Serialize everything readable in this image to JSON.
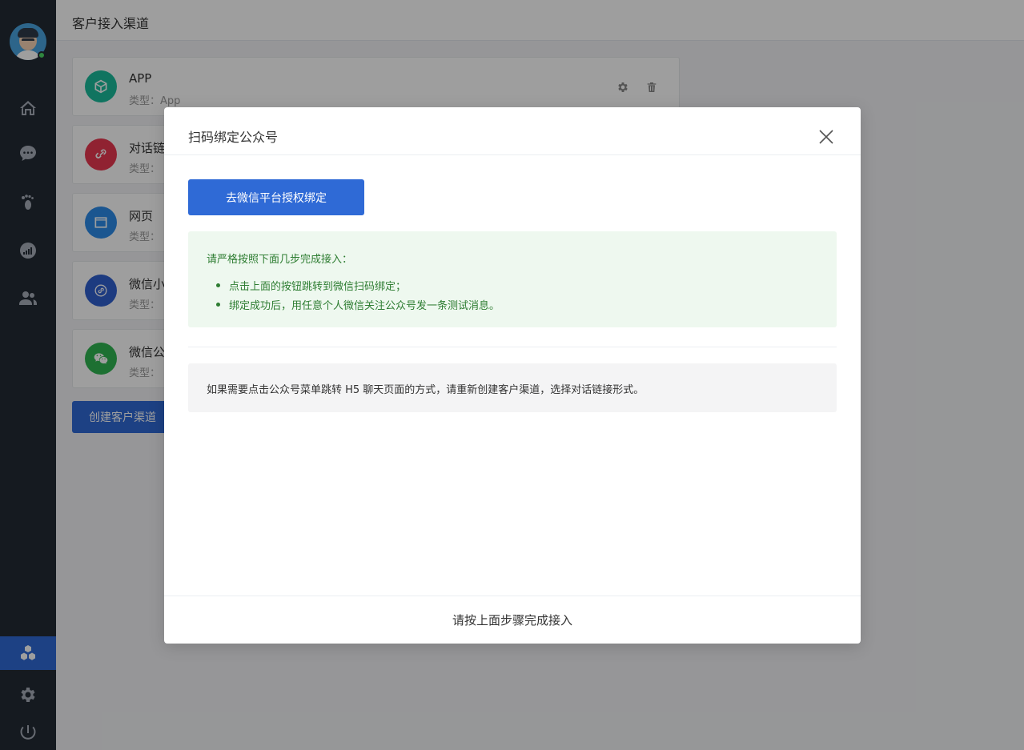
{
  "page": {
    "title": "客户接入渠道"
  },
  "sidebar": {
    "avatar": {
      "status": "online",
      "status_color": "#4cd964"
    },
    "nav": [
      {
        "icon": "home-icon"
      },
      {
        "icon": "chat-icon"
      },
      {
        "icon": "footprint-icon"
      },
      {
        "icon": "analytics-icon"
      },
      {
        "icon": "users-icon"
      },
      {
        "icon": "channels-icon",
        "active": true
      },
      {
        "icon": "settings-icon"
      },
      {
        "icon": "power-icon"
      }
    ],
    "active_color": "#2f6ad6"
  },
  "channels": [
    {
      "name": "APP",
      "type": "类型：App",
      "icon": "cube-icon",
      "color": "#1abc9c"
    },
    {
      "name": "对话链",
      "type": "类型：",
      "icon": "link-icon",
      "color": "#e8384f"
    },
    {
      "name": "网页",
      "type": "类型：",
      "icon": "window-icon",
      "color": "#2d8ce8"
    },
    {
      "name": "微信小",
      "type": "类型：",
      "icon": "miniprogram-icon",
      "color": "#2f5fcf"
    },
    {
      "name": "微信公",
      "type": "类型：",
      "icon": "wechat-icon",
      "color": "#2fb551"
    }
  ],
  "create_button": "创建客户渠道",
  "modal": {
    "title": "扫码绑定公众号",
    "auth_button": "去微信平台授权绑定",
    "tip_title": "请严格按照下面几步完成接入：",
    "tips": [
      "点击上面的按钮跳转到微信扫码绑定；",
      "绑定成功后，用任意个人微信关注公众号发一条测试消息。"
    ],
    "note": "如果需要点击公众号菜单跳转 H5 聊天页面的方式，请重新创建客户渠道，选择对话链接形式。",
    "footer": "请按上面步骤完成接入"
  }
}
